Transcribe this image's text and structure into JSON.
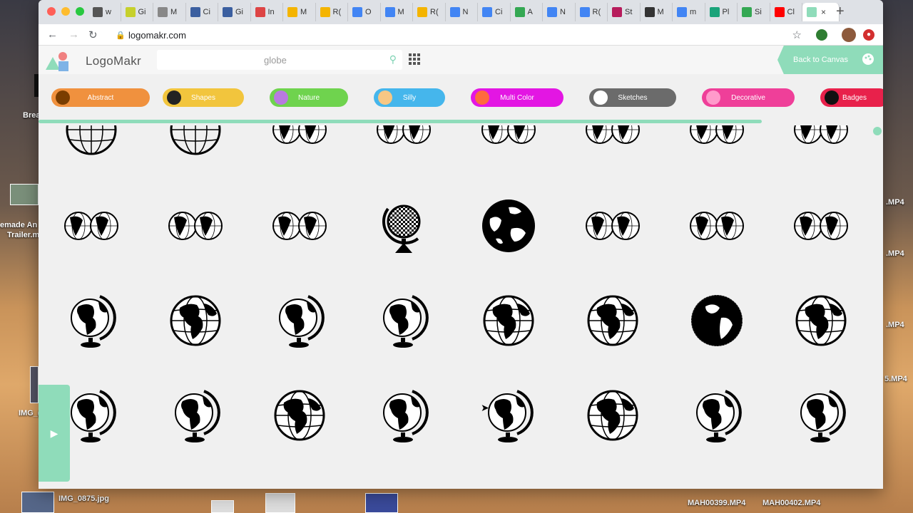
{
  "desktop": {
    "left_labels": [
      "Brea",
      "emade An",
      "Trailer.m",
      "IMG_("
    ],
    "right_labels": [
      ".MP4",
      ".MP4",
      ".MP4",
      "5.MP4"
    ],
    "bottom_labels": [
      "IMG_0875.jpg",
      "MAH00399.MP4",
      "MAH00402.MP4"
    ]
  },
  "browser": {
    "tabs": [
      {
        "label": "w",
        "color": "#555"
      },
      {
        "label": "Gi",
        "color": "#c6d02c"
      },
      {
        "label": "M",
        "color": "#888"
      },
      {
        "label": "Ci",
        "color": "#3b5fa0"
      },
      {
        "label": "Gi",
        "color": "#3b5fa0"
      },
      {
        "label": "In",
        "color": "#d44"
      },
      {
        "label": "M",
        "color": "#f4b400"
      },
      {
        "label": "R(",
        "color": "#f4b400"
      },
      {
        "label": "O",
        "color": "#4285f4"
      },
      {
        "label": "M",
        "color": "#4285f4"
      },
      {
        "label": "R(",
        "color": "#f4b400"
      },
      {
        "label": "N",
        "color": "#4285f4"
      },
      {
        "label": "Ci",
        "color": "#4285f4"
      },
      {
        "label": "A",
        "color": "#34a853"
      },
      {
        "label": "N",
        "color": "#4285f4"
      },
      {
        "label": "R(",
        "color": "#4285f4"
      },
      {
        "label": "St",
        "color": "#b71c5c"
      },
      {
        "label": "M",
        "color": "#333"
      },
      {
        "label": "m",
        "color": "#4285f4"
      },
      {
        "label": "Pl",
        "color": "#1aa37a"
      },
      {
        "label": "Si",
        "color": "#34a853"
      },
      {
        "label": "Cl",
        "color": "#ff0000"
      }
    ],
    "active_tab_close": "×",
    "new_tab": "+",
    "url": "logomakr.com"
  },
  "app": {
    "logo_text": "LogoMakr",
    "search_value": "globe",
    "back_to_canvas": "Back to Canvas",
    "categories": [
      {
        "label": "Abstract",
        "color": "#f0913e",
        "icon_color": "#7a3d00"
      },
      {
        "label": "Shapes",
        "color": "#f2c53d",
        "icon_color": "#222"
      },
      {
        "label": "Nature",
        "color": "#6fd34e",
        "icon_color": "#b87ae0"
      },
      {
        "label": "Silly",
        "color": "#45b6ec",
        "icon_color": "#f7c784"
      },
      {
        "label": "Multi Color",
        "color": "#e316e3",
        "icon_color": "#ff6a3d"
      },
      {
        "label": "Sketches",
        "color": "#6b6b6b",
        "icon_color": "#fff"
      },
      {
        "label": "Decorative",
        "color": "#ef3f99",
        "icon_color": "#ff9acb"
      },
      {
        "label": "Badges",
        "color": "#e8214b",
        "icon_color": "#111"
      }
    ],
    "gallery_rows": [
      [
        "wire-globe",
        "wire-globe",
        "double-globe",
        "double-globe",
        "double-globe",
        "double-globe",
        "double-globe",
        "double-globe"
      ],
      [
        "double-globe",
        "double-globe",
        "double-globe",
        "desk-globe-checker",
        "solid-earth",
        "double-globe",
        "double-globe",
        "double-globe"
      ],
      [
        "desk-globe",
        "grid-globe",
        "desk-globe",
        "desk-globe",
        "grid-globe",
        "grid-globe",
        "solid-globe",
        "grid-globe"
      ],
      [
        "desk-globe",
        "desk-globe",
        "grid-globe",
        "desk-globe",
        "desk-globe",
        "grid-globe",
        "desk-globe",
        "desk-globe"
      ]
    ],
    "play_icon": "▶"
  }
}
